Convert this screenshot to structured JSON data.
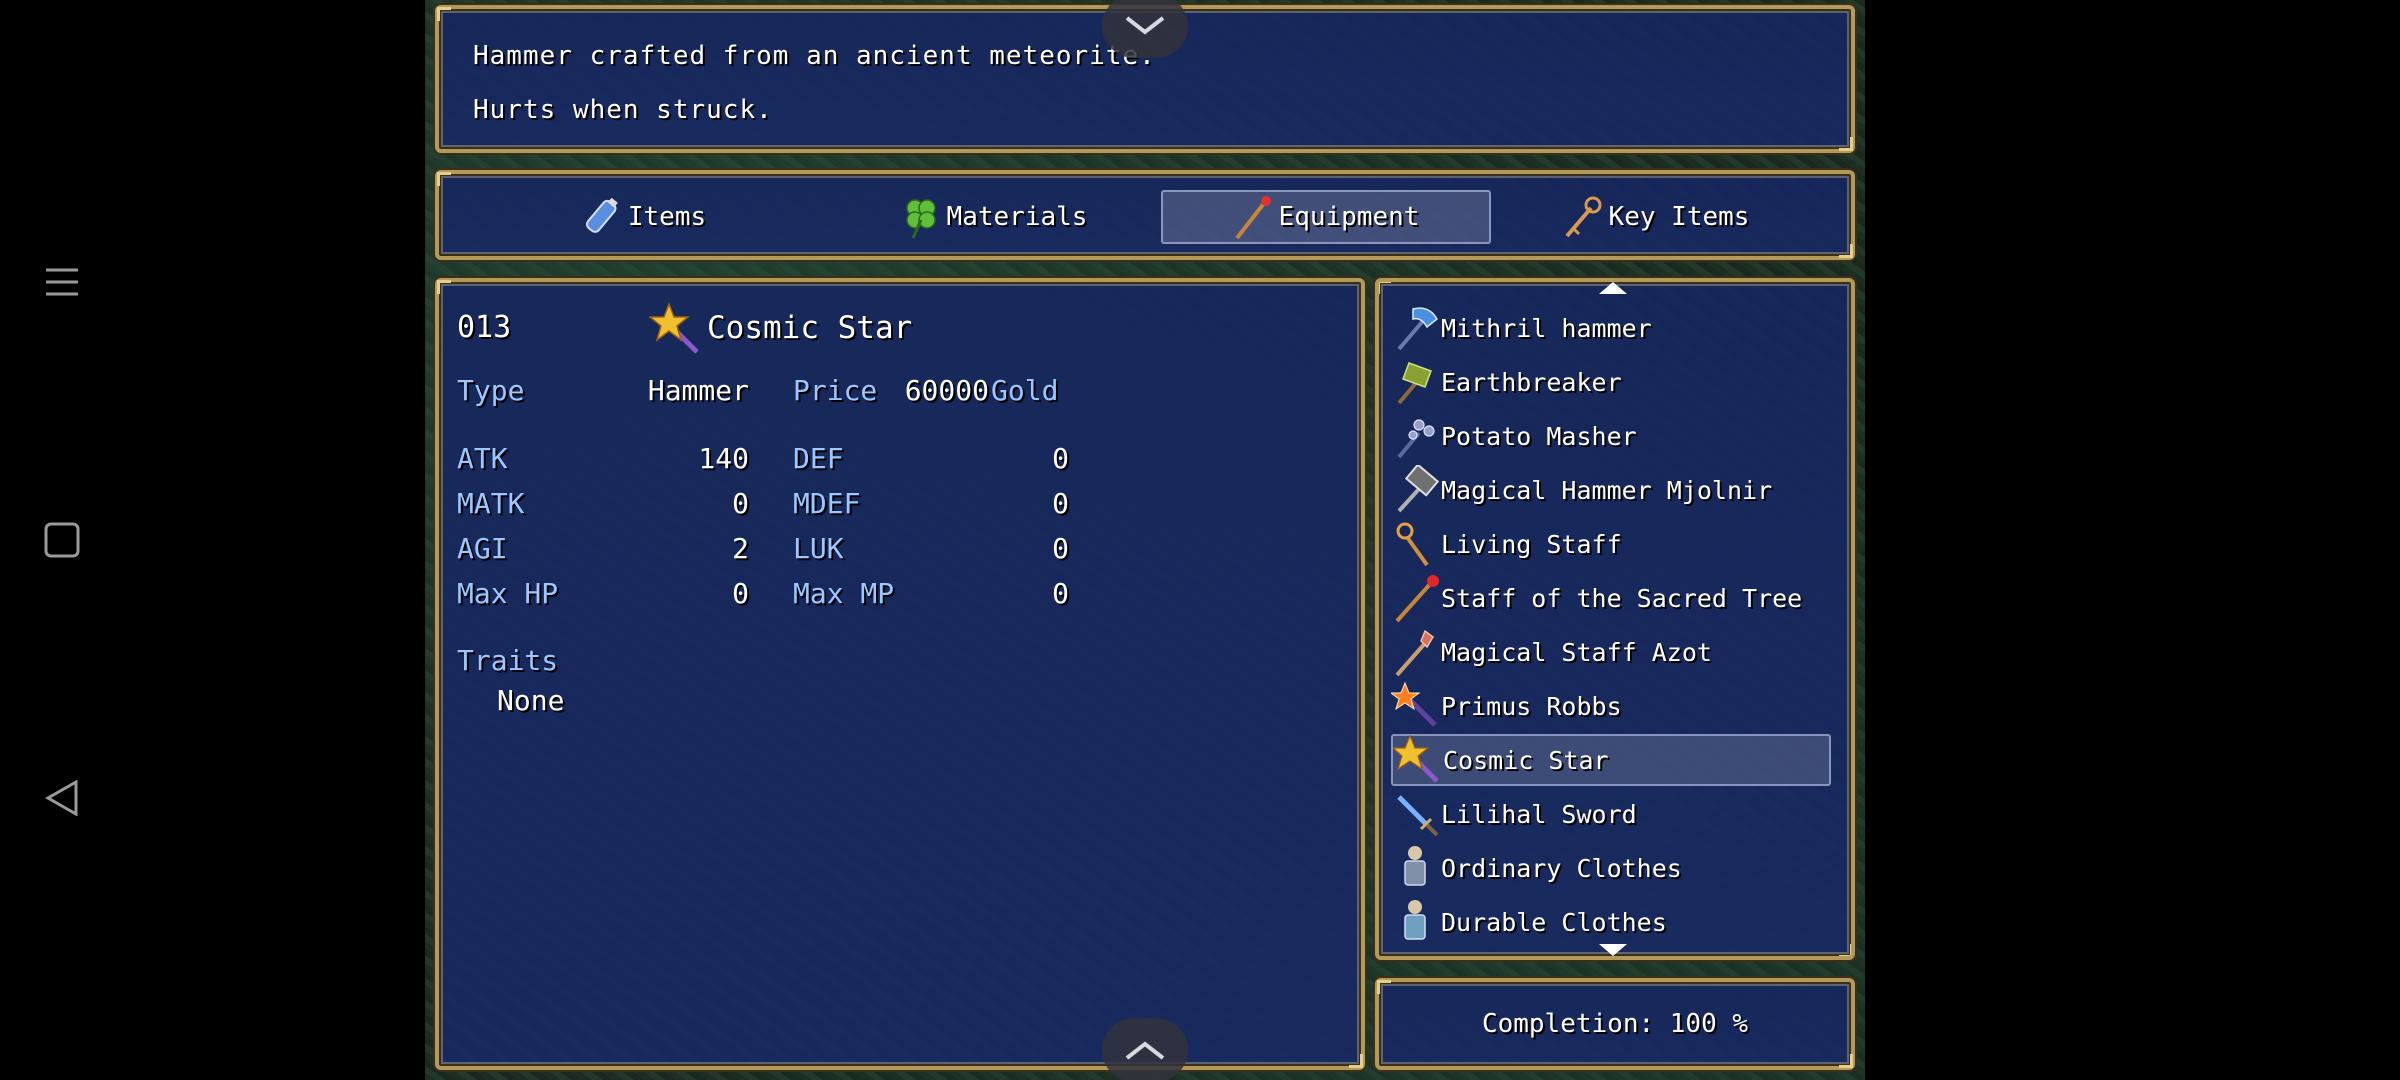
{
  "help": {
    "line1": "Hammer crafted from an ancient meteorite.",
    "line2": "Hurts when struck."
  },
  "tabs": [
    {
      "label": "Items",
      "icon": "potion-icon"
    },
    {
      "label": "Materials",
      "icon": "clover-icon"
    },
    {
      "label": "Equipment",
      "icon": "staff-icon",
      "active": true
    },
    {
      "label": "Key Items",
      "icon": "key-icon"
    }
  ],
  "detail": {
    "number": "013",
    "name": "Cosmic Star",
    "type_label": "Type",
    "type_value": "Hammer",
    "price_label": "Price",
    "price_value": "60000",
    "currency": "Gold",
    "stats": [
      {
        "l1": "ATK",
        "v1": "140",
        "l2": "DEF",
        "v2": "0"
      },
      {
        "l1": "MATK",
        "v1": "0",
        "l2": "MDEF",
        "v2": "0"
      },
      {
        "l1": "AGI",
        "v1": "2",
        "l2": "LUK",
        "v2": "0"
      },
      {
        "l1": "Max HP",
        "v1": "0",
        "l2": "Max MP",
        "v2": "0"
      }
    ],
    "traits_label": "Traits",
    "traits_value": "None"
  },
  "list": [
    {
      "label": "Mithril hammer",
      "icon": "hammer-icon"
    },
    {
      "label": "Earthbreaker",
      "icon": "hammer-icon"
    },
    {
      "label": "Potato Masher",
      "icon": "hammer-icon"
    },
    {
      "label": "Magical Hammer Mjolnir",
      "icon": "hammer-icon"
    },
    {
      "label": "Living Staff",
      "icon": "staff-icon"
    },
    {
      "label": "Staff of the Sacred Tree",
      "icon": "staff-icon"
    },
    {
      "label": "Magical Staff Azot",
      "icon": "staff-icon"
    },
    {
      "label": "Primus Robbs",
      "icon": "wand-icon"
    },
    {
      "label": "Cosmic Star",
      "icon": "star-wand-icon",
      "selected": true
    },
    {
      "label": "Lilihal Sword",
      "icon": "sword-icon"
    },
    {
      "label": "Ordinary Clothes",
      "icon": "clothes-icon"
    },
    {
      "label": "Durable Clothes",
      "icon": "clothes-icon"
    }
  ],
  "completion": "Completion: 100 %",
  "colors": {
    "label": "#9cc8ff",
    "window": "#18286a",
    "frame": "#b49a5a"
  }
}
